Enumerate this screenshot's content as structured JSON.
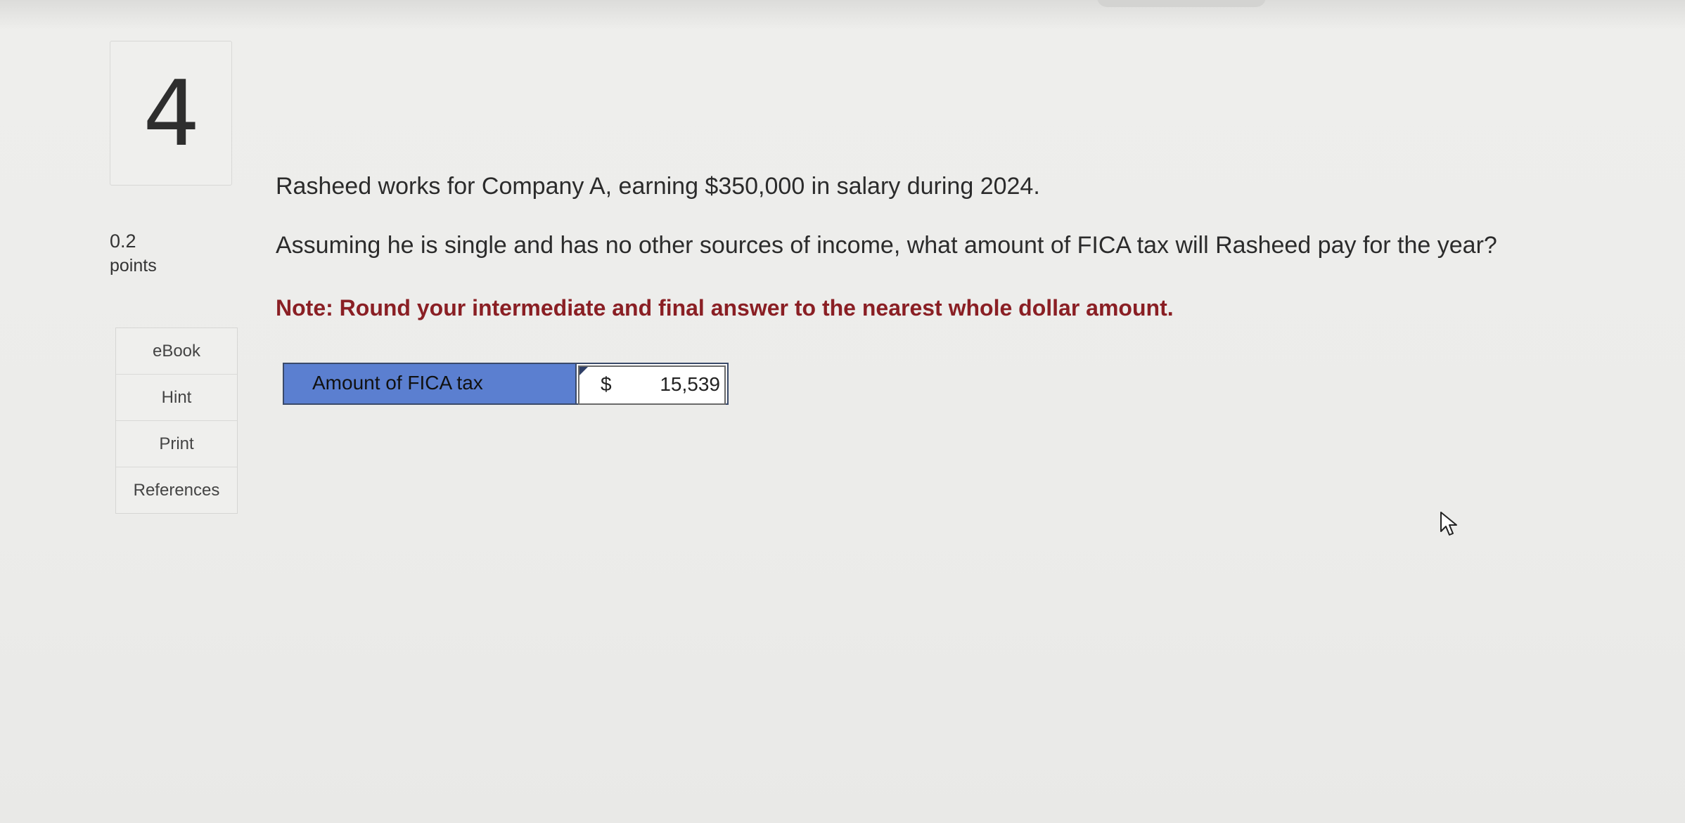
{
  "question": {
    "number": "4",
    "points_value": "0.2",
    "points_label": "points",
    "line1": "Rasheed works for Company A, earning $350,000 in salary during 2024.",
    "line2": "Assuming he is single and has no other sources of income, what amount of FICA tax will Rasheed pay for the year?",
    "note": "Note: Round your intermediate and final answer to the nearest whole dollar amount."
  },
  "tools": {
    "items": [
      {
        "label": "eBook"
      },
      {
        "label": "Hint"
      },
      {
        "label": "Print"
      },
      {
        "label": "References"
      }
    ]
  },
  "answer": {
    "label": "Amount of FICA tax",
    "currency": "$",
    "value": "15,539"
  },
  "colors": {
    "label_cell": "#5b7fd0",
    "note_text": "#8a1f24"
  },
  "icons": {
    "cursor": "mouse-pointer-icon"
  }
}
